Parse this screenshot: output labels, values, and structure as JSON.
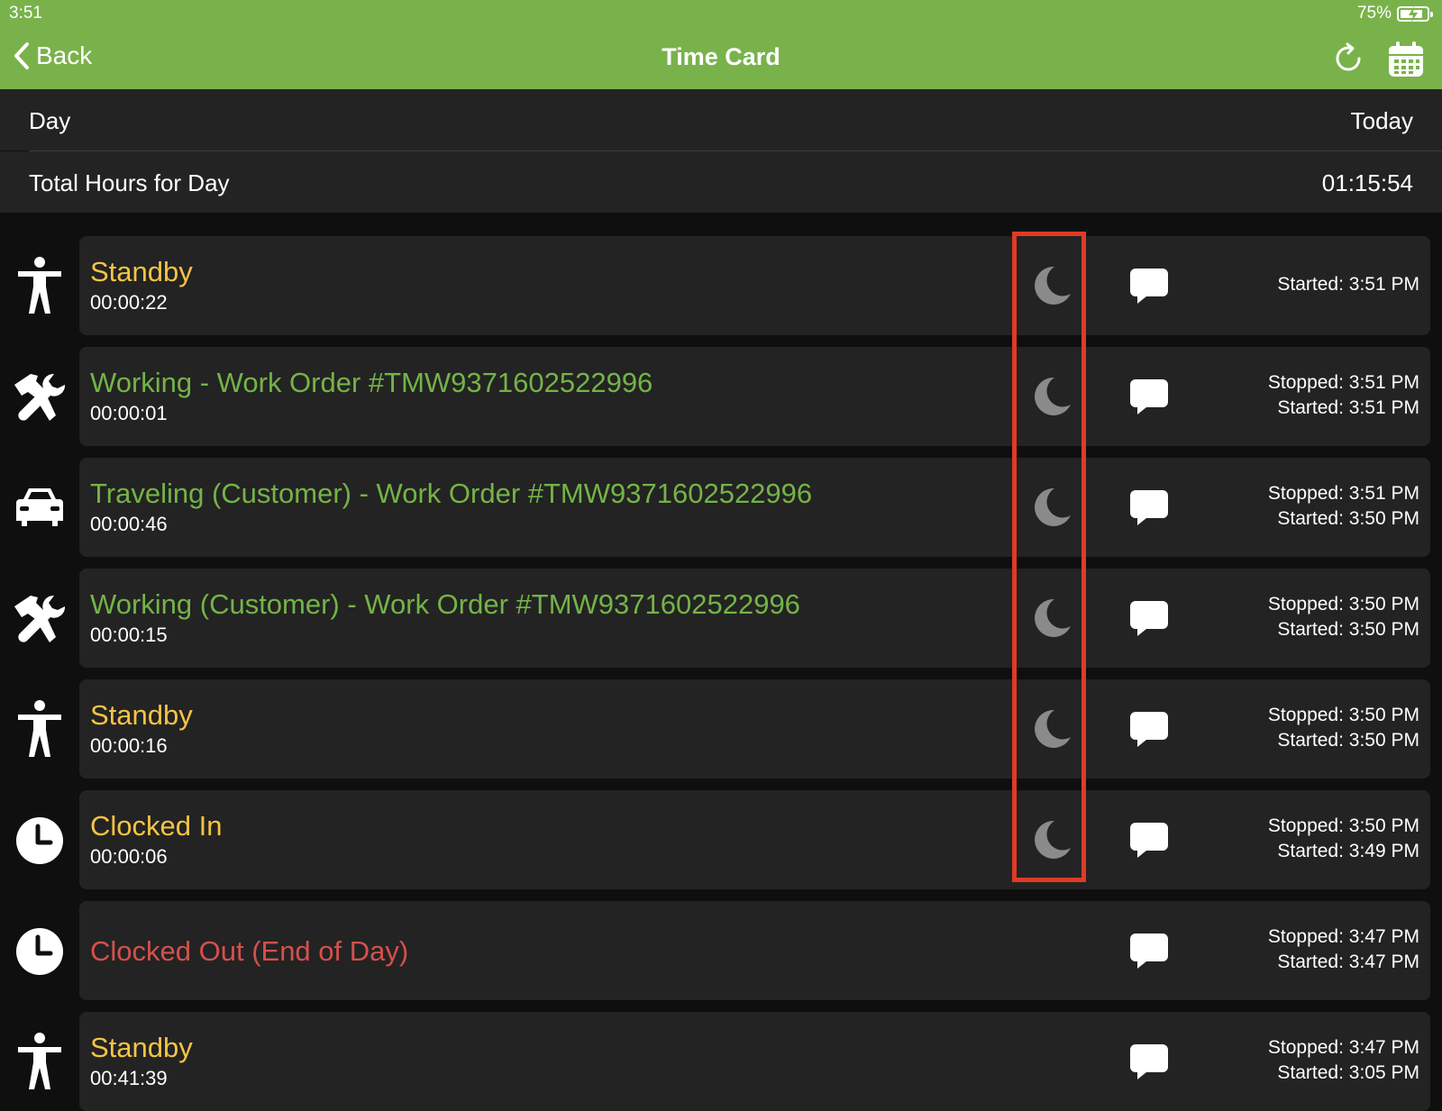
{
  "status_bar": {
    "time": "3:51",
    "battery_text": "75%",
    "battery_level": 0.75
  },
  "header": {
    "back_label": "Back",
    "title": "Time Card",
    "background": "#79b24b"
  },
  "summary": {
    "day_label": "Day",
    "day_value": "Today",
    "total_label": "Total Hours for Day",
    "total_value": "01:15:54"
  },
  "entries": [
    {
      "icon": "standby-person-icon",
      "name": "Standby",
      "name_color": "yellow",
      "duration": "00:00:22",
      "stopped": "",
      "started": "Started: 3:51 PM",
      "has_moon": true
    },
    {
      "icon": "tools-icon",
      "name": "Working - Work Order #TMW9371602522996",
      "name_color": "green",
      "duration": "00:00:01",
      "stopped": "Stopped: 3:51 PM",
      "started": "Started: 3:51 PM",
      "has_moon": true
    },
    {
      "icon": "car-icon",
      "name": "Traveling (Customer) - Work Order #TMW9371602522996",
      "name_color": "green",
      "duration": "00:00:46",
      "stopped": "Stopped: 3:51 PM",
      "started": "Started: 3:50 PM",
      "has_moon": true
    },
    {
      "icon": "tools-icon",
      "name": "Working (Customer) - Work Order #TMW9371602522996",
      "name_color": "green",
      "duration": "00:00:15",
      "stopped": "Stopped: 3:50 PM",
      "started": "Started: 3:50 PM",
      "has_moon": true
    },
    {
      "icon": "standby-person-icon",
      "name": "Standby",
      "name_color": "yellow",
      "duration": "00:00:16",
      "stopped": "Stopped: 3:50 PM",
      "started": "Started: 3:50 PM",
      "has_moon": true
    },
    {
      "icon": "clock-icon",
      "name": "Clocked In",
      "name_color": "yellow",
      "duration": "00:00:06",
      "stopped": "Stopped: 3:50 PM",
      "started": "Started: 3:49 PM",
      "has_moon": true
    },
    {
      "icon": "clock-icon",
      "name": "Clocked Out (End of Day)",
      "name_color": "red",
      "duration": "",
      "stopped": "Stopped: 3:47 PM",
      "started": "Started: 3:47 PM",
      "has_moon": false
    },
    {
      "icon": "standby-person-icon",
      "name": "Standby",
      "name_color": "yellow",
      "duration": "00:41:39",
      "stopped": "Stopped: 3:47 PM",
      "started": "Started: 3:05 PM",
      "has_moon": false
    }
  ],
  "colors": {
    "yellow": "#f6c443",
    "green": "#74b447",
    "red": "#d6504b",
    "highlight": "#e03a26"
  }
}
